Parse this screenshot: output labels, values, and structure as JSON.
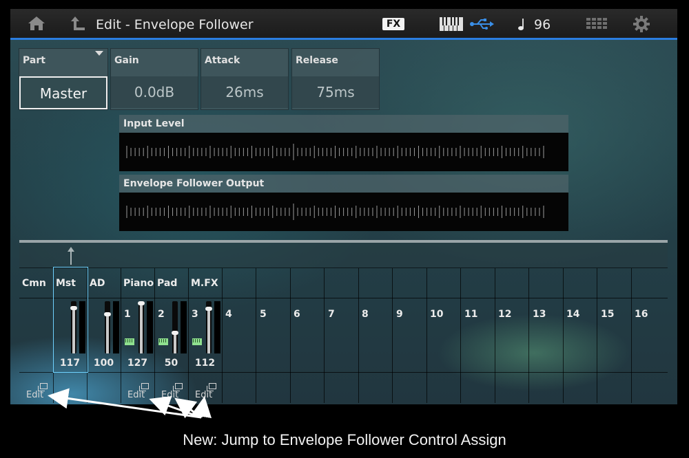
{
  "header": {
    "title": "Edit - Envelope Follower",
    "fx_label": "FX",
    "tempo": "96"
  },
  "params": [
    {
      "label": "Part",
      "value": "Master"
    },
    {
      "label": "Gain",
      "value": "0.0dB"
    },
    {
      "label": "Attack",
      "value": "26ms"
    },
    {
      "label": "Release",
      "value": "75ms"
    }
  ],
  "meters": {
    "input_label": "Input Level",
    "output_label": "Envelope Follower Output"
  },
  "parts": {
    "cmn": {
      "name": "Cmn",
      "edit": "Edit"
    },
    "mst": {
      "name": "Mst",
      "volume": "117",
      "level": 0.9
    },
    "ad": {
      "name": "AD",
      "volume": "100",
      "level": 0.77
    },
    "piano": {
      "name": "Piano",
      "number": "1",
      "volume": "127",
      "level": 1.0,
      "edit": "Edit"
    },
    "pad": {
      "name": "Pad",
      "number": "2",
      "volume": "50",
      "level": 0.39,
      "edit": "Edit"
    },
    "mfx": {
      "name": "M.FX",
      "number": "3",
      "volume": "112",
      "level": 0.88,
      "edit": "Edit"
    },
    "empty_numbers": [
      "4",
      "5",
      "6",
      "7",
      "8",
      "9",
      "10",
      "11",
      "12",
      "13",
      "14",
      "15",
      "16"
    ]
  },
  "caption": "New: Jump to Envelope Follower Control Assign",
  "colors": {
    "accent": "#2b7de0",
    "selection": "#6fd2ff",
    "keyboard_indicator": "#8fe08f"
  },
  "icons": [
    "home-icon",
    "back-arrow-icon",
    "keyboard-icon",
    "usb-icon",
    "note-icon",
    "grid-icon",
    "gear-icon"
  ]
}
